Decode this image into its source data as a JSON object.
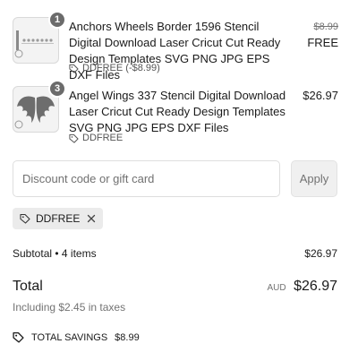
{
  "line_items": [
    {
      "quantity": "1",
      "title": "Anchors Wheels Border 1596 Stencil Digital Download Laser Cricut Cut Ready Design Templates SVG PNG JPG EPS DXF Files",
      "discount_label": "DDFREE (-$8.99)",
      "original_price": "$8.99",
      "price": "FREE"
    },
    {
      "quantity": "3",
      "title": "Angel Wings 337 Stencil Digital Download Laser Cricut Cut Ready Design Templates SVG PNG JPG EPS DXF Files",
      "discount_label": "DDFREE",
      "price": "$26.97"
    }
  ],
  "discount": {
    "placeholder": "Discount code or gift card",
    "apply_label": "Apply",
    "applied_code": "DDFREE"
  },
  "summary": {
    "subtotal_label": "Subtotal • 4 items",
    "subtotal_value": "$26.97",
    "total_label": "Total",
    "currency": "AUD",
    "total_value": "$26.97",
    "taxes_note": "Including $2.45 in taxes",
    "savings_label": "TOTAL SAVINGS",
    "savings_value": "$8.99"
  },
  "colors": {
    "muted": "#737373",
    "chip_bg": "#ebebeb",
    "badge_bg": "#6b6b6b"
  }
}
